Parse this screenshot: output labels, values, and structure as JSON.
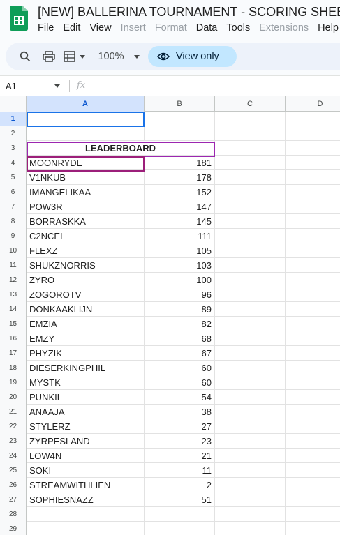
{
  "header": {
    "title": "[NEW] BALLERINA TOURNAMENT - SCORING SHEET",
    "menu": [
      {
        "label": "File",
        "disabled": false
      },
      {
        "label": "Edit",
        "disabled": false
      },
      {
        "label": "View",
        "disabled": false
      },
      {
        "label": "Insert",
        "disabled": true
      },
      {
        "label": "Format",
        "disabled": true
      },
      {
        "label": "Data",
        "disabled": false
      },
      {
        "label": "Tools",
        "disabled": false
      },
      {
        "label": "Extensions",
        "disabled": true
      },
      {
        "label": "Help",
        "disabled": false
      }
    ]
  },
  "toolbar": {
    "zoom": "100%",
    "view_only_label": "View only",
    "icons": [
      "search-icon",
      "print-icon",
      "format-paint-icon",
      "chevron-down-icon",
      "eye-icon"
    ]
  },
  "formula_bar": {
    "cell_ref": "A1",
    "fx": "fx"
  },
  "grid": {
    "columns": [
      "A",
      "B",
      "C",
      "D"
    ],
    "active_column": "A",
    "active_row": 1,
    "rows": [
      {
        "n": "1",
        "a": "",
        "b": ""
      },
      {
        "n": "2",
        "a": "",
        "b": ""
      },
      {
        "n": "3",
        "merged": "LEADERBOARD"
      },
      {
        "n": "4",
        "a": "MOONRYDE",
        "b": "181"
      },
      {
        "n": "5",
        "a": "V1NKUB",
        "b": "178"
      },
      {
        "n": "6",
        "a": "IMANGELIKAA",
        "b": "152"
      },
      {
        "n": "7",
        "a": "POW3R",
        "b": "147"
      },
      {
        "n": "8",
        "a": "BORRASKKA",
        "b": "145"
      },
      {
        "n": "9",
        "a": "C2NCEL",
        "b": "111"
      },
      {
        "n": "10",
        "a": "FLEXZ",
        "b": "105"
      },
      {
        "n": "11",
        "a": "SHUKZNORRIS",
        "b": "103"
      },
      {
        "n": "12",
        "a": "ZYRO",
        "b": "100"
      },
      {
        "n": "13",
        "a": "ZOGOROTV",
        "b": "96"
      },
      {
        "n": "14",
        "a": "DONKAAKLIJN",
        "b": "89"
      },
      {
        "n": "15",
        "a": "EMZIA",
        "b": "82"
      },
      {
        "n": "16",
        "a": "EMZY",
        "b": "68"
      },
      {
        "n": "17",
        "a": "PHYZIK",
        "b": "67"
      },
      {
        "n": "18",
        "a": "DIESERKINGPHIL",
        "b": "60"
      },
      {
        "n": "19",
        "a": "MYSTK",
        "b": "60"
      },
      {
        "n": "20",
        "a": "PUNKIL",
        "b": "54"
      },
      {
        "n": "21",
        "a": "ANAAJA",
        "b": "38"
      },
      {
        "n": "22",
        "a": "STYLERZ",
        "b": "27"
      },
      {
        "n": "23",
        "a": "ZYRPESLAND",
        "b": "23"
      },
      {
        "n": "24",
        "a": "LOW4N",
        "b": "21"
      },
      {
        "n": "25",
        "a": "SOKI",
        "b": "11"
      },
      {
        "n": "26",
        "a": "STREAMWITHLIEN",
        "b": "2"
      },
      {
        "n": "27",
        "a": "SOPHIESNAZZ",
        "b": "51"
      },
      {
        "n": "28",
        "a": "",
        "b": ""
      },
      {
        "n": "29",
        "a": "",
        "b": ""
      }
    ]
  },
  "colors": {
    "accent": "#1a73e8",
    "sheets_green": "#0f9d58",
    "view_only_bg": "#c2e7ff",
    "leaderboard_border": "#9c27b0"
  }
}
